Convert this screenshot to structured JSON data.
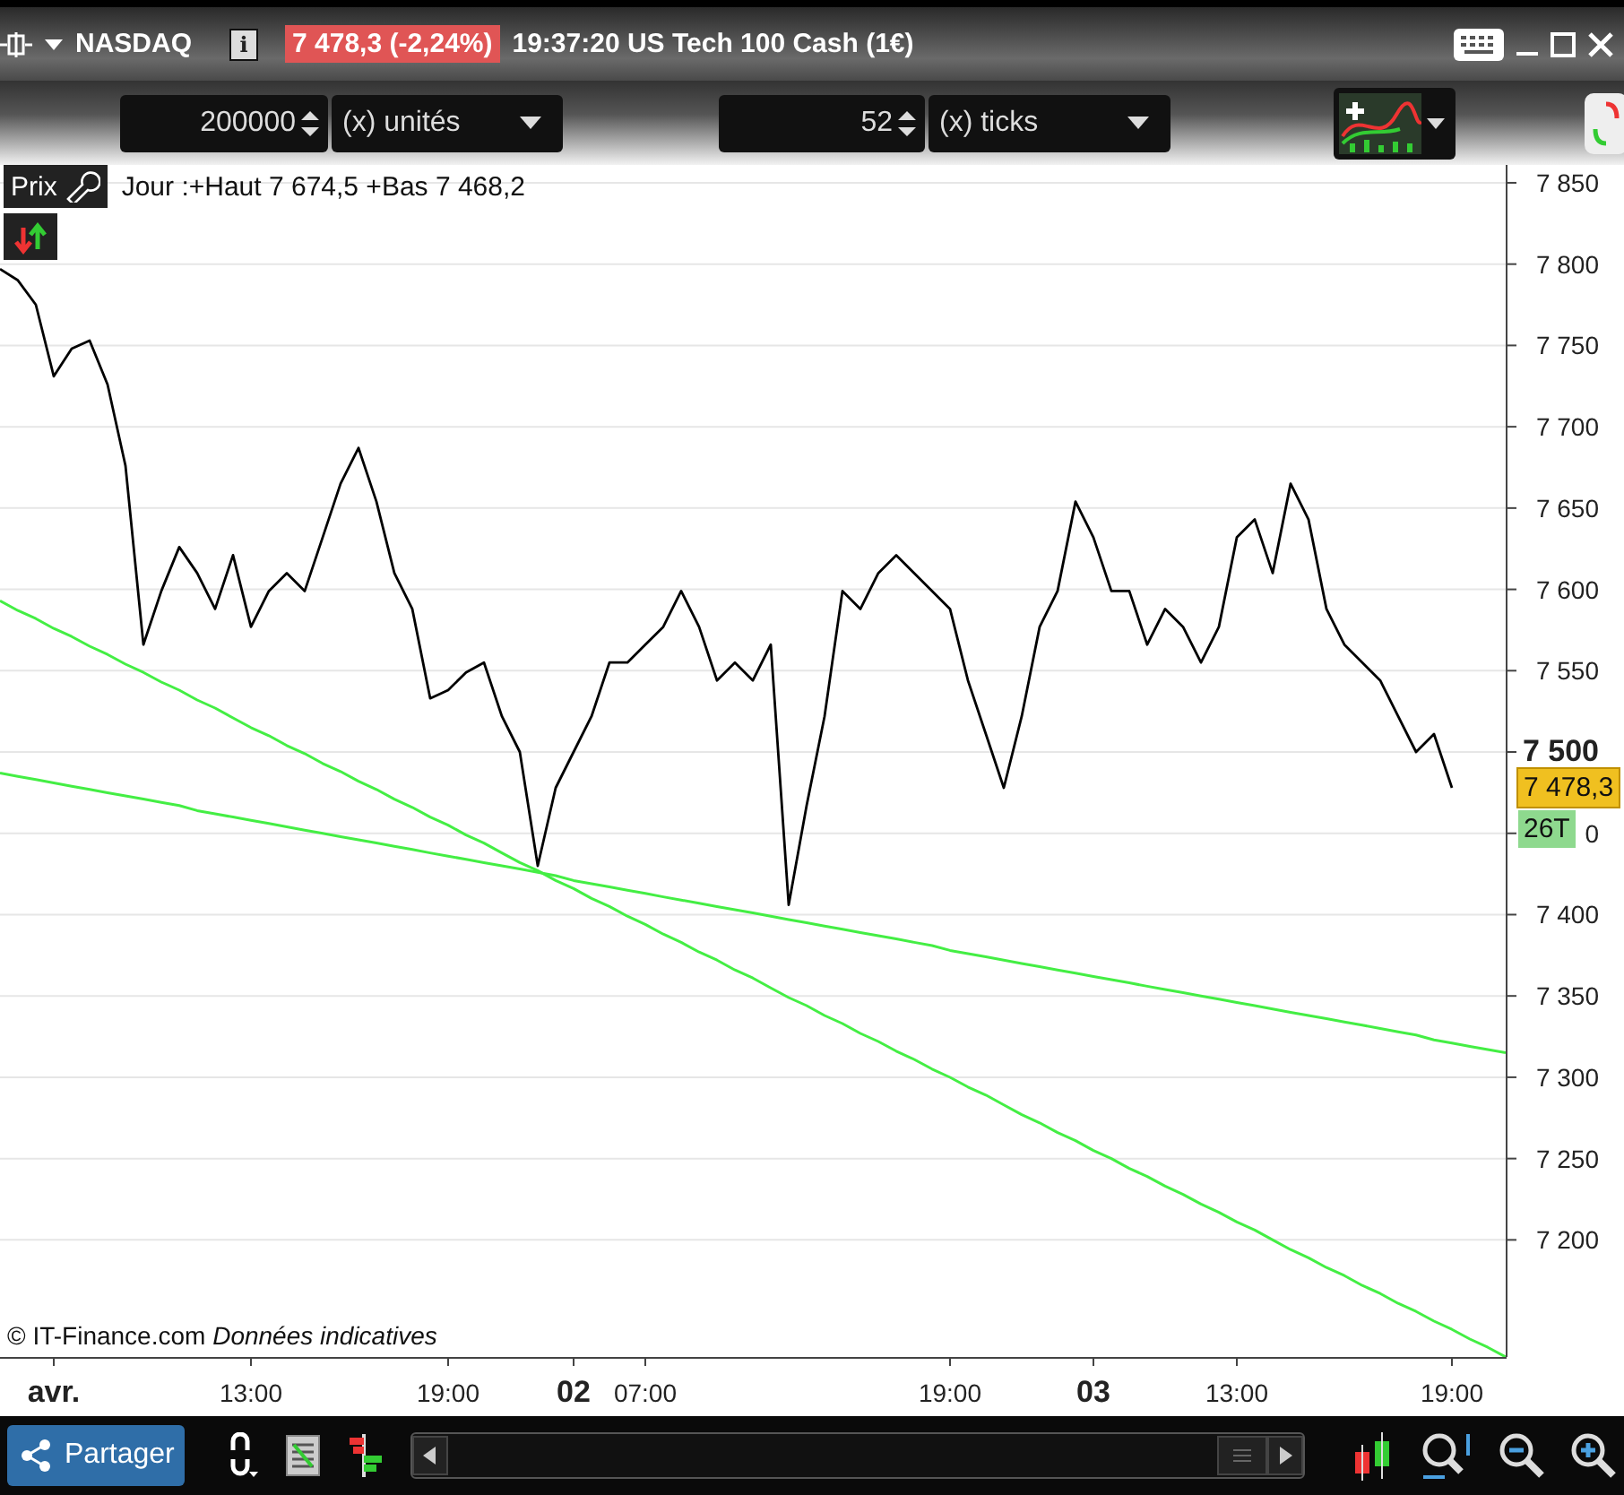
{
  "title_bar": {
    "instrument": "NASDAQ",
    "info": "i",
    "price_badge": "7 478,3 (-2,24%)",
    "description": "19:37:20 US Tech 100 Cash (1€)"
  },
  "order_bar": {
    "quantity": "200000",
    "quantity_unit": "(x) unités",
    "ticks": "52",
    "ticks_unit": "(x) ticks"
  },
  "chart": {
    "legend_label": "Prix",
    "summary": "Jour :+Haut 7 674,5 +Bas 7 468,2",
    "credit": "© IT-Finance.com *Données indicatives*",
    "price_tag": "7 478,3",
    "tick_badge": "26T",
    "partial_tick_label": "0",
    "chart_data": {
      "type": "line",
      "grid": true,
      "ylim": [
        7128,
        7861
      ],
      "categories": [
        null,
        null,
        null,
        "avr.",
        null,
        null,
        null,
        null,
        null,
        null,
        null,
        null,
        null,
        null,
        "13:00",
        null,
        null,
        null,
        null,
        null,
        null,
        null,
        null,
        null,
        null,
        "19:00",
        null,
        null,
        null,
        null,
        null,
        null,
        "02",
        null,
        null,
        null,
        "07:00",
        null,
        null,
        null,
        null,
        null,
        null,
        null,
        null,
        null,
        null,
        null,
        null,
        null,
        null,
        null,
        null,
        "19:00",
        null,
        null,
        null,
        null,
        null,
        null,
        null,
        "03",
        null,
        null,
        null,
        null,
        null,
        null,
        null,
        "13:00",
        null,
        null,
        null,
        null,
        null,
        null,
        null,
        null,
        null,
        null,
        null,
        "19:00",
        null,
        null,
        null
      ],
      "series": [
        {
          "color": "#000000",
          "values": [
            7797,
            7790,
            7775,
            7731,
            7748,
            7753,
            7726,
            7676,
            7566,
            7599,
            7626,
            7610,
            7588,
            7621,
            7577,
            7599,
            7610,
            7599,
            7632,
            7665,
            7687,
            7654,
            7610,
            7588,
            7533,
            7538,
            7549,
            7555,
            7522,
            7500,
            7430,
            7478,
            7500,
            7522,
            7555,
            7555,
            7566,
            7577,
            7599,
            7577,
            7544,
            7555,
            7544,
            7566,
            7406,
            7467,
            7522,
            7599,
            7588,
            7610,
            7621,
            7610,
            7599,
            7588,
            7544,
            7511,
            7478,
            7522,
            7577,
            7599,
            7654,
            7632,
            7599,
            7599,
            7566,
            7588,
            7577,
            7555,
            7577,
            7632,
            7643,
            7610,
            7665,
            7643,
            7588,
            7566,
            7555,
            7544,
            7522,
            7500,
            7511,
            7478,
            null,
            null,
            null
          ]
        },
        {
          "color": "#44ee44",
          "values": [
            7593,
            7587,
            7582,
            7576,
            7571,
            7565,
            7560,
            7554,
            7549,
            7543,
            7538,
            7532,
            7527,
            7521,
            7515,
            7510,
            7504,
            7499,
            7493,
            7488,
            7482,
            7477,
            7471,
            7466,
            7460,
            7455,
            7449,
            7444,
            7438,
            7432,
            7427,
            7421,
            7416,
            7410,
            7405,
            7399,
            7394,
            7388,
            7383,
            7377,
            7372,
            7366,
            7361,
            7355,
            7349,
            7344,
            7338,
            7333,
            7327,
            7322,
            7316,
            7311,
            7305,
            7300,
            7294,
            7289,
            7283,
            7277,
            7272,
            7266,
            7261,
            7255,
            7250,
            7244,
            7239,
            7233,
            7228,
            7222,
            7217,
            7211,
            7206,
            7200,
            7194,
            7189,
            7183,
            7178,
            7172,
            7167,
            7161,
            7156,
            7150,
            7145,
            7139,
            7134,
            7128
          ]
        },
        {
          "color": "#44ee44",
          "values": [
            7487,
            7485,
            7483,
            7481,
            7479,
            7477,
            7475,
            7473,
            7471,
            7469,
            7467,
            7464,
            7462,
            7460,
            7458,
            7456,
            7454,
            7452,
            7450,
            7448,
            7446,
            7444,
            7442,
            7440,
            7438,
            7436,
            7434,
            7432,
            7430,
            7428,
            7426,
            7424,
            7421,
            7419,
            7417,
            7415,
            7413,
            7411,
            7409,
            7407,
            7405,
            7403,
            7401,
            7399,
            7397,
            7395,
            7393,
            7391,
            7389,
            7387,
            7385,
            7383,
            7381,
            7378,
            7376,
            7374,
            7372,
            7370,
            7368,
            7366,
            7364,
            7362,
            7360,
            7358,
            7356,
            7354,
            7352,
            7350,
            7348,
            7346,
            7344,
            7342,
            7340,
            7338,
            7336,
            7334,
            7332,
            7330,
            7328,
            7326,
            7323,
            7321,
            7319,
            7317,
            7315
          ]
        }
      ],
      "yticks": [
        7200,
        7250,
        7300,
        7350,
        7400,
        7500,
        7550,
        7600,
        7650,
        7700,
        7750,
        7800,
        7850
      ]
    }
  },
  "bottom_bar": {
    "share_button": "Partager"
  }
}
